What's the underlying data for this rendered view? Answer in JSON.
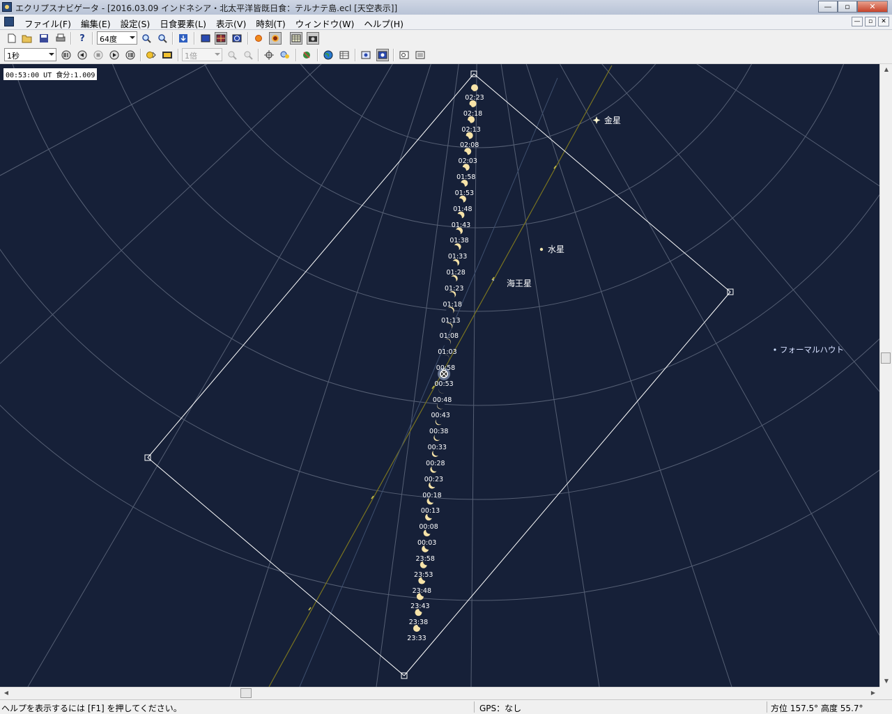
{
  "window": {
    "title": "エクリプスナビゲータ - [2016.03.09 インドネシア・北太平洋皆既日食：テルナテ島.ecl [天空表示]]",
    "minimize": "—",
    "maximize": "▫",
    "close": "✕"
  },
  "menu": {
    "items": [
      "ファイル(F)",
      "編集(E)",
      "設定(S)",
      "日食要素(L)",
      "表示(V)",
      "時刻(T)",
      "ウィンドウ(W)",
      "ヘルプ(H)"
    ],
    "mdi": [
      "—",
      "▫",
      "✕"
    ]
  },
  "toolbar1": {
    "fov_value": "64度"
  },
  "toolbar2": {
    "step_value": "1秒",
    "speed_value": "1倍"
  },
  "sky": {
    "time_readout": "00:53:00 UT 食分:1.009",
    "labels": {
      "venus": "金星",
      "mercury": "水星",
      "neptune": "海王星",
      "fomalhaut": "フォーマルハウト"
    },
    "sun_times": [
      "02:23",
      "02:18",
      "02:13",
      "02:08",
      "02:03",
      "01:58",
      "01:53",
      "01:48",
      "01:43",
      "01:38",
      "01:33",
      "01:28",
      "01:23",
      "01:18",
      "01:13",
      "01:08",
      "01:03",
      "00:58",
      "00:53",
      "00:48",
      "00:43",
      "00:38",
      "00:33",
      "00:28",
      "00:23",
      "00:18",
      "00:13",
      "00:08",
      "00:03",
      "23:58",
      "23:53",
      "23:48",
      "23:43",
      "23:38",
      "23:33"
    ]
  },
  "status": {
    "help": "ヘルプを表示するには [F1] を押してください。",
    "gps": "GPS：なし",
    "position": "方位 157.5°  高度  55.7°"
  },
  "colors": {
    "sky": "#162038",
    "grid": "#6b7488",
    "ecliptic": "#7a7420",
    "sun": "#f6e3a8",
    "frame": "#ffffff"
  }
}
